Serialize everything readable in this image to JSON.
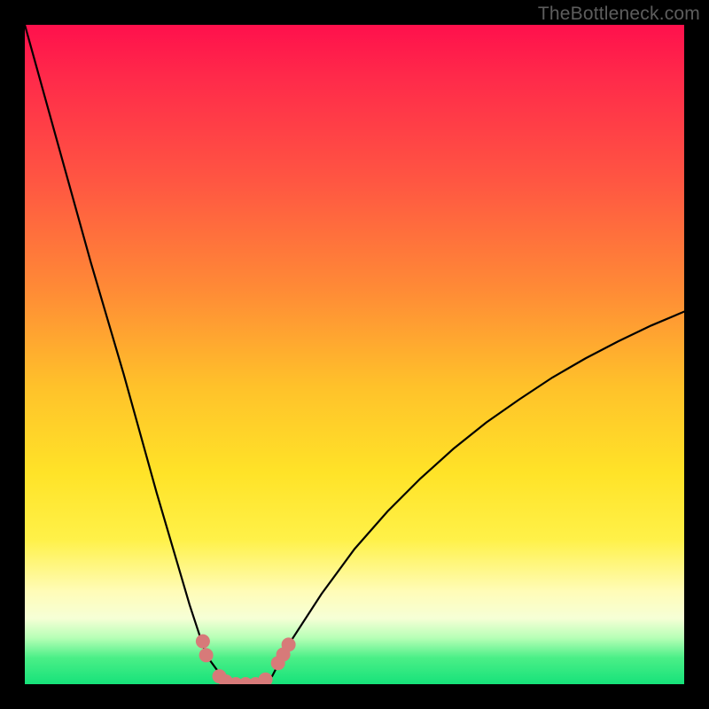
{
  "watermark": "TheBottleneck.com",
  "colors": {
    "frame": "#000000",
    "gradient_stops": [
      "#ff104c",
      "#ff2a4a",
      "#ff5742",
      "#ff8a36",
      "#ffc22a",
      "#ffe328",
      "#fff148",
      "#fffcb8",
      "#f6ffd6",
      "#b6ffb6",
      "#4bef87",
      "#16e27a"
    ],
    "curve": "#000000",
    "markers": "#d77a79"
  },
  "chart_data": {
    "type": "line",
    "title": "",
    "xlabel": "",
    "ylabel": "",
    "x": [
      0.0,
      0.05,
      0.1,
      0.15,
      0.2,
      0.25,
      0.275,
      0.3,
      0.325,
      0.35,
      0.375,
      0.4,
      0.45,
      0.5,
      0.55,
      0.6,
      0.65,
      0.7,
      0.75,
      0.8,
      0.85,
      0.9,
      0.95,
      1.0
    ],
    "y": [
      1.0,
      0.82,
      0.64,
      0.47,
      0.29,
      0.12,
      0.044,
      0.01,
      0.0,
      0.0,
      0.012,
      0.06,
      0.137,
      0.205,
      0.262,
      0.312,
      0.357,
      0.397,
      0.432,
      0.465,
      0.494,
      0.52,
      0.544,
      0.565
    ],
    "xlim": [
      0,
      1
    ],
    "ylim": [
      0,
      1
    ],
    "markers": [
      {
        "x": 0.27,
        "y": 0.065
      },
      {
        "x": 0.275,
        "y": 0.044
      },
      {
        "x": 0.295,
        "y": 0.012
      },
      {
        "x": 0.305,
        "y": 0.004
      },
      {
        "x": 0.32,
        "y": 0.0
      },
      {
        "x": 0.335,
        "y": 0.0
      },
      {
        "x": 0.35,
        "y": 0.0
      },
      {
        "x": 0.365,
        "y": 0.007
      },
      {
        "x": 0.384,
        "y": 0.032
      },
      {
        "x": 0.392,
        "y": 0.045
      },
      {
        "x": 0.4,
        "y": 0.06
      }
    ]
  }
}
